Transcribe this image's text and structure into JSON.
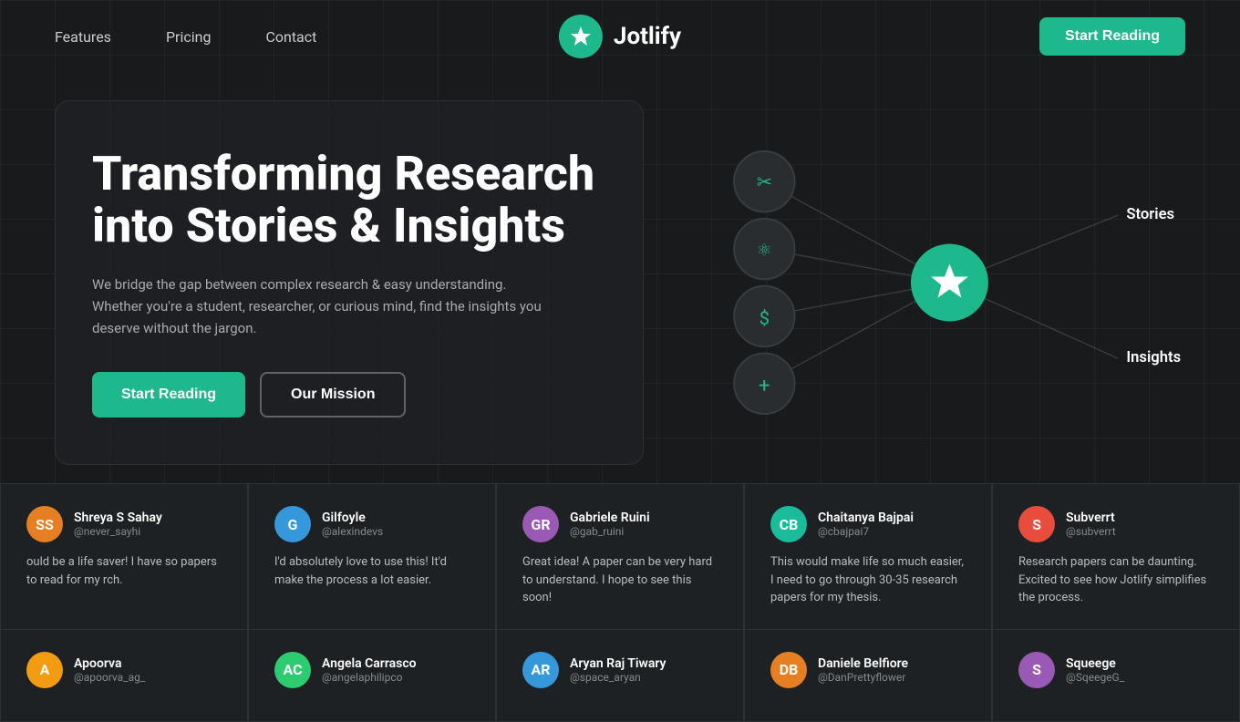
{
  "navbar": {
    "links": [
      {
        "id": "features",
        "label": "Features"
      },
      {
        "id": "pricing",
        "label": "Pricing"
      },
      {
        "id": "contact",
        "label": "Contact"
      }
    ],
    "logo_text": "Jotlify",
    "cta_label": "Start Reading"
  },
  "hero": {
    "title_line1": "Transforming Research",
    "title_line2": "into Stories & Insights",
    "subtitle_line1": "We bridge the gap between complex research & easy understanding.",
    "subtitle_line2": "Whether you're a student, researcher, or curious mind, find the insights you deserve without the jargon.",
    "btn_start": "Start Reading",
    "btn_mission": "Our Mission",
    "diagram": {
      "label_stories": "Stories",
      "label_insights": "Insights"
    }
  },
  "testimonials_row1": [
    {
      "name": "Shreya S Sahay",
      "handle": "@never_sayhi",
      "text": "ould be a life saver! I have so papers to read for my rch.",
      "color": "#e67e22"
    },
    {
      "name": "Gilfoyle",
      "handle": "@alexindevs",
      "text": "I'd absolutely love to use this! It'd make the process a lot easier.",
      "color": "#3498db"
    },
    {
      "name": "Gabriele Ruini",
      "handle": "@gab_ruini",
      "text": "Great idea! A paper can be very hard to understand. I hope to see this soon!",
      "color": "#9b59b6"
    },
    {
      "name": "Chaitanya Bajpai",
      "handle": "@cbajpai7",
      "text": "This would make life so much easier, I need to go through 30-35 research papers for my thesis.",
      "color": "#1abc9c"
    },
    {
      "name": "Subverrt",
      "handle": "@subverrt",
      "text": "Research papers can be daunting. Excited to see how Jotlify simplifies the process.",
      "color": "#e74c3c"
    }
  ],
  "testimonials_row2": [
    {
      "name": "Apoorva",
      "handle": "@apoorva_ag_",
      "text": "",
      "color": "#f39c12"
    },
    {
      "name": "Angela Carrasco",
      "handle": "@angelaphilipco",
      "text": "",
      "color": "#2ecc71"
    },
    {
      "name": "Aryan Raj Tiwary",
      "handle": "@space_aryan",
      "text": "",
      "color": "#3498db"
    },
    {
      "name": "Daniele Belfiore",
      "handle": "@DanPrettyflower",
      "text": "",
      "color": "#e67e22"
    },
    {
      "name": "Squeege",
      "handle": "@SqeegeG_",
      "text": "",
      "color": "#9b59b6"
    }
  ]
}
